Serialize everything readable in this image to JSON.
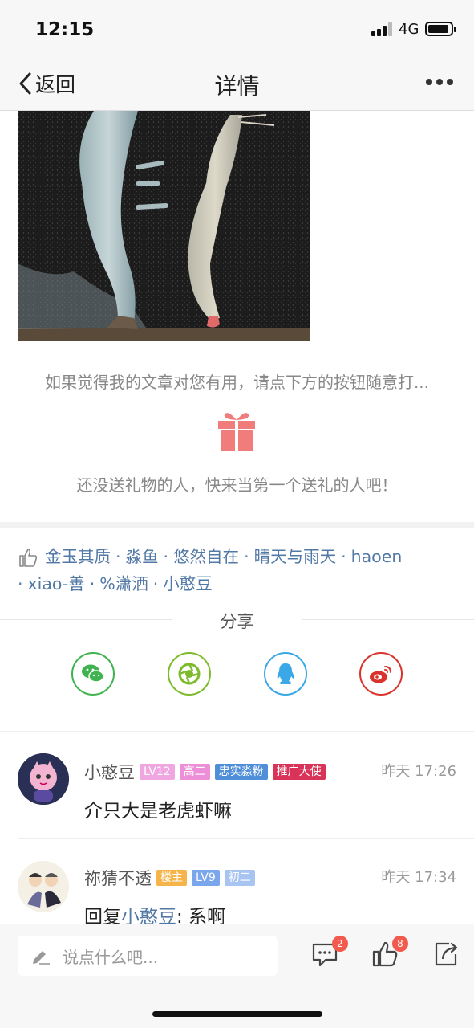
{
  "status": {
    "time": "12:15",
    "network": "4G"
  },
  "nav": {
    "back_label": "返回",
    "title": "详情"
  },
  "reward": {
    "prompt": "如果觉得我的文章对您有用，请点下方的按钮随意打...",
    "empty": "还没送礼物的人，快来当第一个送礼的人吧！"
  },
  "likes": {
    "users": [
      "金玉其质",
      "淼鱼",
      "悠然自在",
      "晴天与雨天",
      "haoen",
      "xiao-善",
      "%潇洒",
      "小憨豆"
    ]
  },
  "share": {
    "label": "分享",
    "targets": [
      {
        "name": "wechat-icon",
        "color": "#3fb34f"
      },
      {
        "name": "moments-icon",
        "color": "#7dbb2c"
      },
      {
        "name": "qq-icon",
        "color": "#3aa7e6"
      },
      {
        "name": "weibo-icon",
        "color": "#d9332c"
      }
    ]
  },
  "comments": [
    {
      "author": "小憨豆",
      "tags": [
        {
          "text": "LV12",
          "color": "#f0a6e0"
        },
        {
          "text": "高二",
          "color": "#ec8fd8"
        },
        {
          "text": "忠实淼粉",
          "color": "#4f8ed8"
        },
        {
          "text": "推广大使",
          "color": "#d9335a"
        }
      ],
      "time": "昨天 17:26",
      "text": "介只大是老虎虾嘛"
    },
    {
      "author": "祢猜不透",
      "tags": [
        {
          "text": "楼主",
          "color": "#f5b54a"
        },
        {
          "text": "LV9",
          "color": "#7aa7ec"
        },
        {
          "text": "初二",
          "color": "#a8c4f0"
        }
      ],
      "time": "昨天 17:34",
      "reply_prefix": "回复",
      "mention": "小憨豆",
      "text": ": 系啊"
    }
  ],
  "bottom": {
    "placeholder": "说点什么吧...",
    "comment_count": "2",
    "like_count": "8"
  }
}
